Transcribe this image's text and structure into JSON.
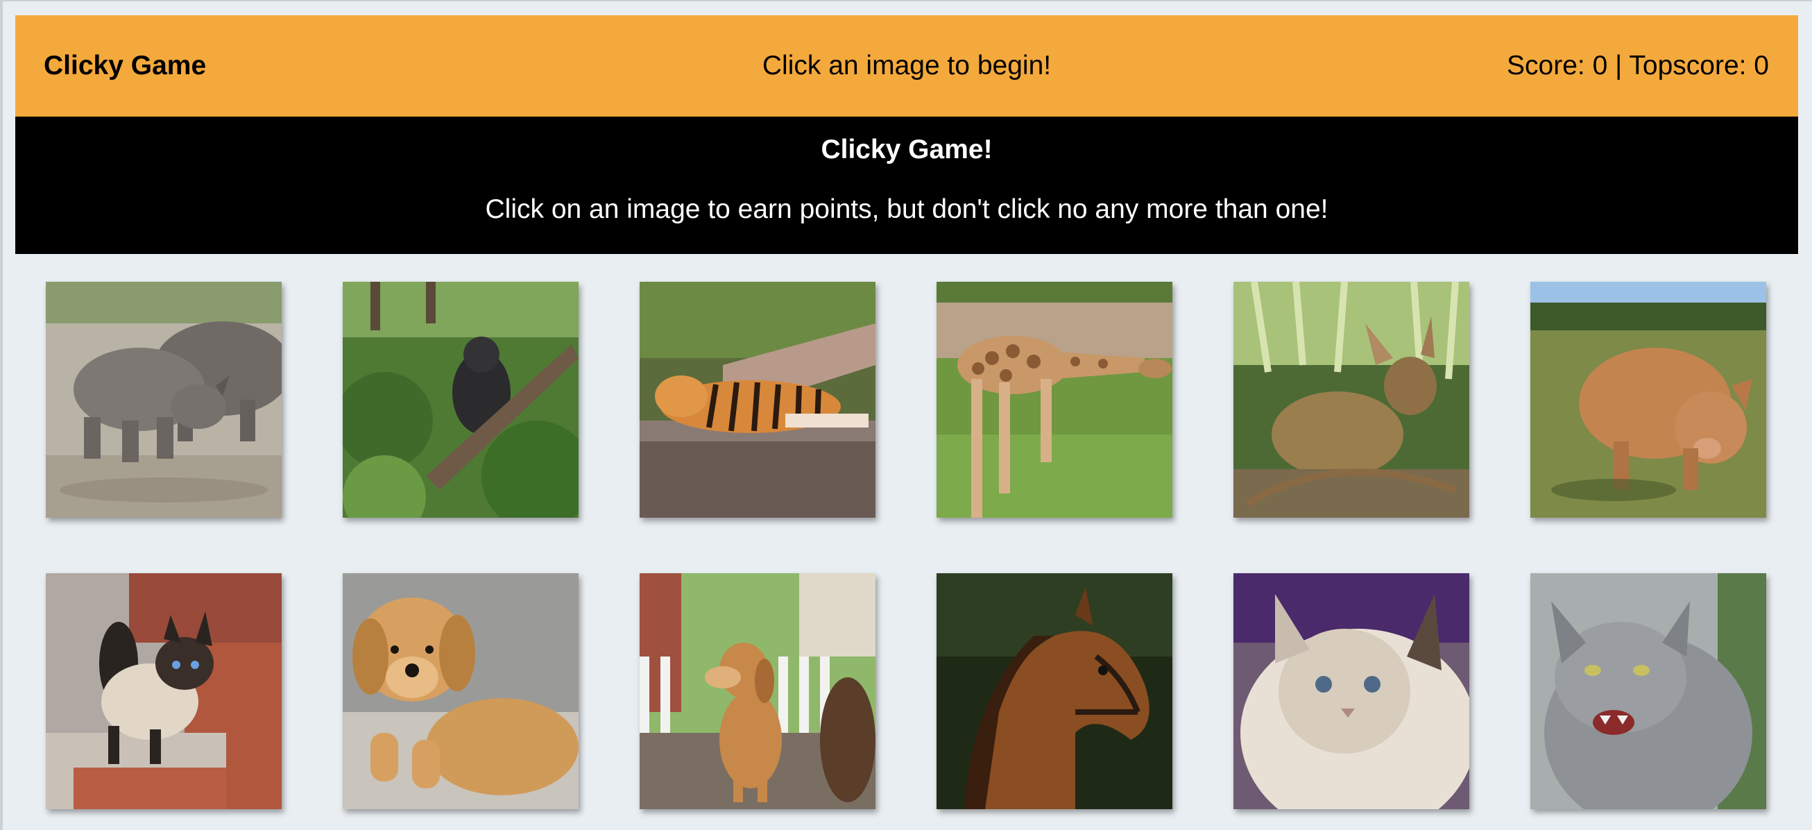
{
  "navbar": {
    "brand": "Clicky Game",
    "status": "Click an image to begin!",
    "score_text": "Score: 0 | Topscore: 0",
    "background": "#f4a93c"
  },
  "hero": {
    "title": "Clicky Game!",
    "subtitle": "Click on an image to earn points, but don't click no any more than one!",
    "background": "#000000"
  },
  "cards": [
    {
      "animal": "rhinoceros",
      "icon": "rhino-image"
    },
    {
      "animal": "gorilla",
      "icon": "gorilla-image"
    },
    {
      "animal": "tiger",
      "icon": "tiger-image"
    },
    {
      "animal": "giraffe",
      "icon": "giraffe-image"
    },
    {
      "animal": "deer",
      "icon": "deer-image"
    },
    {
      "animal": "pig",
      "icon": "pig-image"
    },
    {
      "animal": "siamese cat",
      "icon": "siamese-cat-image"
    },
    {
      "animal": "puppy",
      "icon": "puppy-image"
    },
    {
      "animal": "dog",
      "icon": "dog-image"
    },
    {
      "animal": "horse",
      "icon": "horse-image"
    },
    {
      "animal": "fluffy cat",
      "icon": "fluffy-cat-image"
    },
    {
      "animal": "grey cat",
      "icon": "grey-cat-image"
    }
  ]
}
